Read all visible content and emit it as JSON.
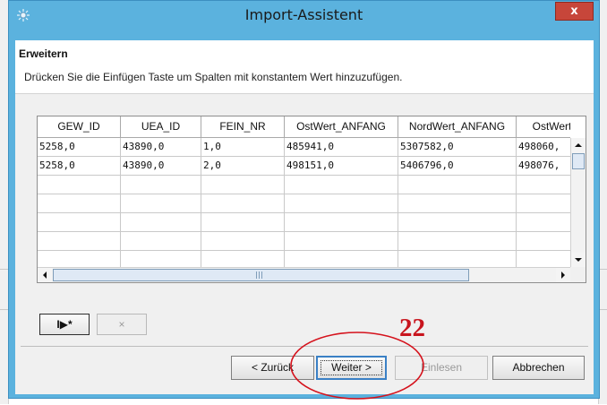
{
  "window": {
    "title": "Import-Assistent",
    "close_label": "x"
  },
  "step": {
    "title": "Erweitern",
    "description": "Drücken Sie die Einfügen Taste um Spalten mit konstantem Wert hinzuzufügen."
  },
  "table": {
    "columns": [
      "GEW_ID",
      "UEA_ID",
      "FEIN_NR",
      "OstWert_ANFANG",
      "NordWert_ANFANG",
      "OstWert"
    ],
    "rows": [
      [
        "5258,0",
        "43890,0",
        "1,0",
        "485941,0",
        "5307582,0",
        "498060,"
      ],
      [
        "5258,0",
        "43890,0",
        "2,0",
        "498151,0",
        "5406796,0",
        "498076,"
      ],
      [
        "",
        "",
        "",
        "",
        "",
        ""
      ],
      [
        "",
        "",
        "",
        "",
        "",
        ""
      ],
      [
        "",
        "",
        "",
        "",
        "",
        ""
      ],
      [
        "",
        "",
        "",
        "",
        "",
        ""
      ],
      [
        "",
        "",
        "",
        "",
        "",
        ""
      ]
    ]
  },
  "small_buttons": {
    "add_label": "I▶*",
    "remove_label": "×"
  },
  "buttons": {
    "back": "< Zurück",
    "next": "Weiter >",
    "import": "Einlesen",
    "cancel": "Abbrechen"
  },
  "annotation": {
    "number": "22",
    "color": "#c8141d"
  },
  "colors": {
    "titlebar": "#5bb2de",
    "close_button": "#c7463a"
  }
}
